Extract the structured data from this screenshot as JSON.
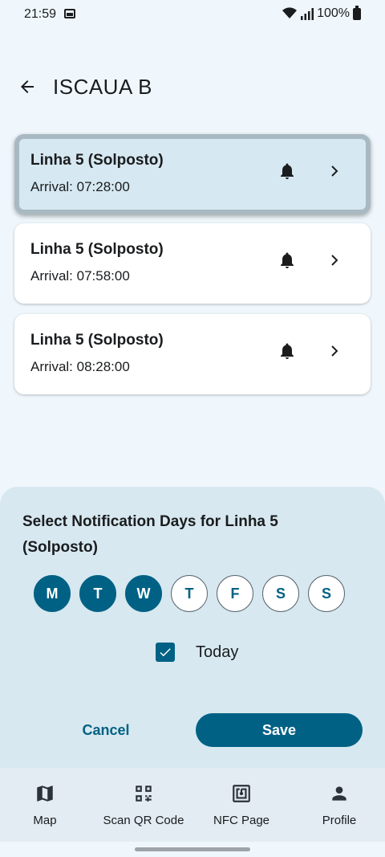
{
  "status": {
    "time": "21:59",
    "battery": "100%"
  },
  "header": {
    "title": "ISCAUA B"
  },
  "arrivals": [
    {
      "title": "Linha 5 (Solposto)",
      "arrival": "Arrival: 07:28:00",
      "selected": true
    },
    {
      "title": "Linha 5 (Solposto)",
      "arrival": "Arrival: 07:58:00",
      "selected": false
    },
    {
      "title": "Linha 5 (Solposto)",
      "arrival": "Arrival: 08:28:00",
      "selected": false
    }
  ],
  "sheet": {
    "title": "Select Notification Days for Linha 5 (Solposto)",
    "days": [
      {
        "label": "M",
        "selected": true
      },
      {
        "label": "T",
        "selected": true
      },
      {
        "label": "W",
        "selected": true
      },
      {
        "label": "T",
        "selected": false
      },
      {
        "label": "F",
        "selected": false
      },
      {
        "label": "S",
        "selected": false
      },
      {
        "label": "S",
        "selected": false
      }
    ],
    "today_label": "Today",
    "today_checked": true,
    "cancel_label": "Cancel",
    "save_label": "Save"
  },
  "nav": {
    "items": [
      {
        "label": "Map",
        "icon": "map-icon"
      },
      {
        "label": "Scan QR Code",
        "icon": "qr-code-icon"
      },
      {
        "label": "NFC Page",
        "icon": "nfc-icon"
      },
      {
        "label": "Profile",
        "icon": "person-icon"
      }
    ]
  },
  "colors": {
    "primary": "#006185",
    "sheet": "#d7e8f0",
    "background": "#f0f7fc"
  }
}
